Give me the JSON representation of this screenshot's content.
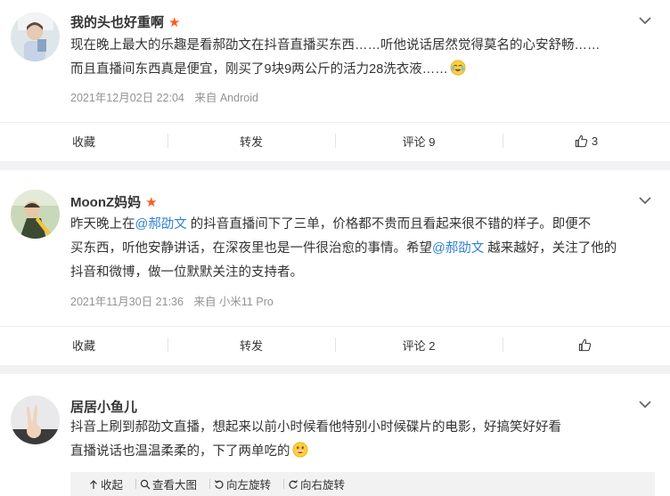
{
  "posts": [
    {
      "author": "我的头也好重啊",
      "content_lines": [
        "现在晚上最大的乐趣是看郝劭文在抖音直播买东西……听他说话居然觉得莫名的心安舒畅……",
        "而且直播间东西真是便宜，刚买了9块9两公斤的活力28洗衣液……"
      ],
      "date": "2021年12月02日 22:04",
      "source": "来自 Android",
      "actions": {
        "collect": "收藏",
        "repost": "转发",
        "comment": "评论 9",
        "like": "3"
      }
    },
    {
      "author": "MoonZ妈妈",
      "content_parts": {
        "p1": "昨天晚上在",
        "at1": "@郝劭文",
        "p2": " 的抖音直播间下了三单，价格都不贵而且看起来很不错的样子。即便不",
        "p3": "买东西，听他安静讲话，在深夜里也是一件很治愈的事情。希望",
        "at2": "@郝劭文",
        "p4": " 越来越好，关注了他的",
        "p5": "抖音和微博，做一位默默关注的支持者。"
      },
      "date": "2021年11月30日 21:36",
      "source": "来自 小米11 Pro",
      "actions": {
        "collect": "收藏",
        "repost": "转发",
        "comment": "评论 2",
        "like": ""
      }
    },
    {
      "author": "居居小鱼儿",
      "content_lines": [
        "抖音上刷到郝劭文直播，想起来以前小时候看他特别小时候碟片的电影，好搞笑好好看",
        "直播说话也温温柔柔的，下了两单吃的"
      ],
      "toolbar": {
        "collapse": "收起",
        "view_large": "查看大图",
        "rotate_left": "向左旋转",
        "rotate_right": "向右旋转"
      }
    }
  ],
  "colors": {
    "link": "#2d7fd6",
    "star": "#ff5a1f",
    "meta": "#939393"
  }
}
